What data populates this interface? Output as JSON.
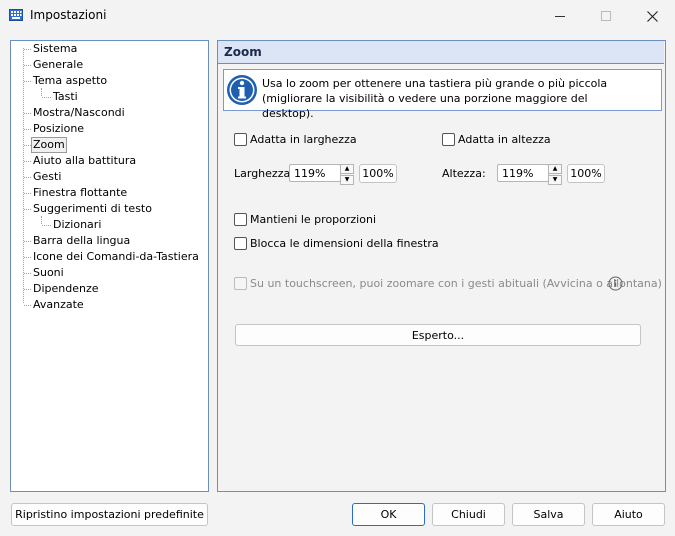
{
  "window": {
    "title": "Impostazioni",
    "icon": "keyboard-icon"
  },
  "tree": {
    "items": [
      {
        "label": "Sistema",
        "level": 0
      },
      {
        "label": "Generale",
        "level": 0
      },
      {
        "label": "Tema aspetto",
        "level": 0
      },
      {
        "label": "Tasti",
        "level": 1
      },
      {
        "label": "Mostra/Nascondi",
        "level": 0
      },
      {
        "label": "Posizione",
        "level": 0
      },
      {
        "label": "Zoom",
        "level": 0,
        "selected": true
      },
      {
        "label": "Aiuto alla battitura",
        "level": 0
      },
      {
        "label": "Gesti",
        "level": 0
      },
      {
        "label": "Finestra flottante",
        "level": 0
      },
      {
        "label": "Suggerimenti di testo",
        "level": 0
      },
      {
        "label": "Dizionari",
        "level": 1
      },
      {
        "label": "Barra della lingua",
        "level": 0
      },
      {
        "label": "Icone dei Comandi-da-Tastiera",
        "level": 0
      },
      {
        "label": "Suoni",
        "level": 0
      },
      {
        "label": "Dipendenze",
        "level": 0
      },
      {
        "label": "Avanzate",
        "level": 0
      }
    ]
  },
  "panel": {
    "title": "Zoom",
    "info": "Usa lo zoom per ottenere una tastiera più grande o più piccola (migliorare la visibilità o vedere una porzione maggiore del desktop).",
    "fit_width_label": "Adatta in larghezza",
    "fit_height_label": "Adatta in altezza",
    "width_label": "Larghezza:",
    "width_value": "119%",
    "width_reset": "100%",
    "height_label": "Altezza:",
    "height_value": "119%",
    "height_reset": "100%",
    "keep_ratio_label": "Mantieni le proporzioni",
    "lock_size_label": "Blocca le dimensioni della finestra",
    "touch_label": "Su un touchscreen, puoi zoomare con i gesti abituali (Avvicina o allontana)",
    "expert_button": "Esperto..."
  },
  "footer": {
    "reset_button": "Ripristino impostazioni predefinite",
    "ok_button": "OK",
    "close_button": "Chiudi",
    "save_button": "Salva",
    "help_button": "Aiuto"
  },
  "colors": {
    "accent": "#2a6ad0",
    "header_bg": "#dbe5f5",
    "info_icon": "#1f5fb0"
  }
}
